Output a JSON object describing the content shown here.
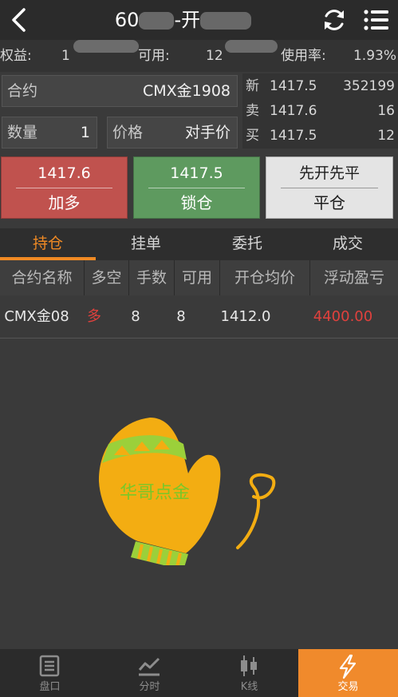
{
  "header": {
    "title_prefix": "60",
    "title_middle": "-开",
    "back_icon": "chevron-left-icon",
    "refresh_icon": "refresh-icon",
    "menu_icon": "list-menu-icon"
  },
  "info": {
    "equity_label": "权益:",
    "equity_value": "1",
    "available_label": "可用:",
    "available_value": "12",
    "usage_label": "使用率:",
    "usage_value": "1.93%"
  },
  "order": {
    "contract_label": "合约",
    "contract_value": "CMX金1908",
    "qty_label": "数量",
    "qty_value": "1",
    "price_label": "价格",
    "price_value": "对手价"
  },
  "quote": [
    {
      "key": "新",
      "price": "1417.5",
      "value": "352199"
    },
    {
      "key": "卖",
      "price": "1417.6",
      "value": "16"
    },
    {
      "key": "买",
      "price": "1417.5",
      "value": "12"
    }
  ],
  "buttons": {
    "long_price": "1417.6",
    "long_label": "加多",
    "lock_price": "1417.5",
    "lock_label": "锁仓",
    "close_top": "先开先平",
    "close_label": "平仓"
  },
  "tabs": [
    "持仓",
    "挂单",
    "委托",
    "成交"
  ],
  "table": {
    "headers": [
      "合约名称",
      "多空",
      "手数",
      "可用",
      "开仓均价",
      "浮动盈亏"
    ],
    "rows": [
      {
        "name": "CMX金08",
        "direction": "多",
        "lots": "8",
        "available": "8",
        "avg_price": "1412.0",
        "pnl": "4400.00"
      }
    ]
  },
  "watermark": {
    "text": "华哥点金",
    "mitten_color": "#f3ad12",
    "stripe_color": "#9bd03a"
  },
  "nav": [
    {
      "label": "盘口",
      "icon": "orderbook-icon"
    },
    {
      "label": "分时",
      "icon": "timeshare-chart-icon"
    },
    {
      "label": "K线",
      "icon": "candlestick-icon"
    },
    {
      "label": "交易",
      "icon": "lightning-icon"
    }
  ],
  "colors": {
    "accent": "#f08a24",
    "buy_red": "#c0524e",
    "lock_green": "#5e9a5f",
    "profit_red": "#e0413d"
  }
}
